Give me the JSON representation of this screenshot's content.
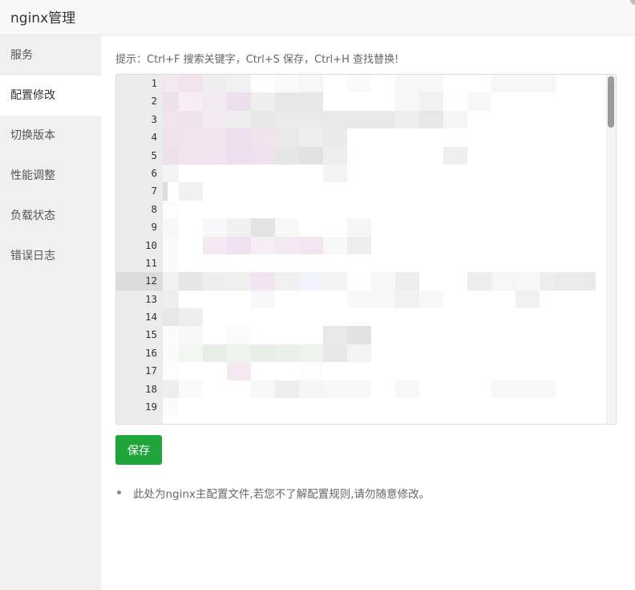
{
  "window": {
    "title": "nginx管理"
  },
  "sidebar": {
    "items": [
      {
        "label": "服务",
        "active": false
      },
      {
        "label": "配置修改",
        "active": true
      },
      {
        "label": "切换版本",
        "active": false
      },
      {
        "label": "性能调整",
        "active": false
      },
      {
        "label": "负载状态",
        "active": false
      },
      {
        "label": "错误日志",
        "active": false
      }
    ]
  },
  "main": {
    "hint": "提示：Ctrl+F 搜索关键字，Ctrl+S 保存，Ctrl+H 查找替换!",
    "editor": {
      "line_numbers": [
        "1",
        "2",
        "3",
        "4",
        "5",
        "6",
        "7",
        "8",
        "9",
        "10",
        "11",
        "12",
        "13",
        "14",
        "15",
        "16",
        "17",
        "18",
        "19"
      ],
      "current_line": "12"
    },
    "save_label": "保存",
    "notes": [
      "此处为nginx主配置文件,若您不了解配置规则,请勿随意修改。"
    ]
  },
  "colors": {
    "accent": "#20a53a",
    "sidebar_bg": "#f0f0f0",
    "gutter_bg": "#ececec"
  }
}
